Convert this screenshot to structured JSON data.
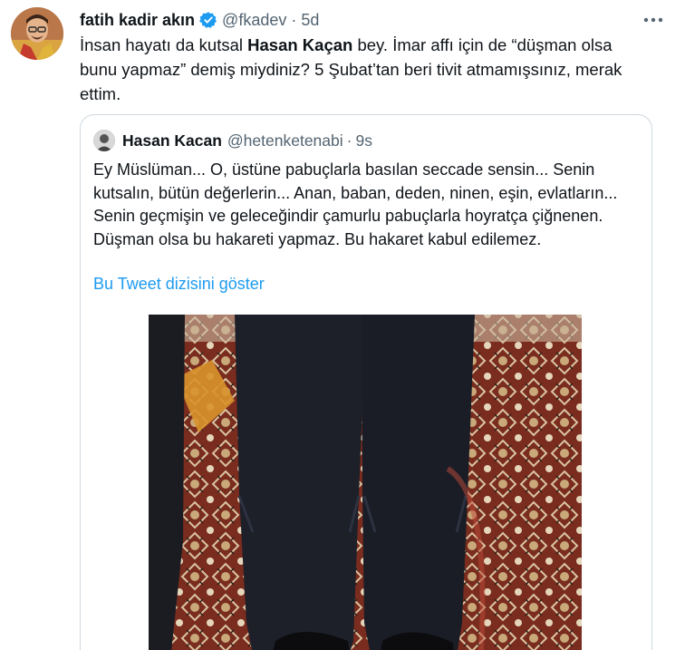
{
  "tweet": {
    "author_name": "fatih kadir akın",
    "handle": "@fkadev",
    "separator": "·",
    "time": "5d",
    "more_icon": "more-icon",
    "text_before": "İnsan hayatı da kutsal ",
    "text_bold": "Hasan Kaçan",
    "text_after": " bey. İmar affı için de “düşman olsa bunu yapmaz” demiş miydiniz? 5 Şubat’tan beri tivit atmamışsınız, merak ettim."
  },
  "quote": {
    "author_name": "Hasan Kacan",
    "handle": "@hetenketenabi",
    "separator": "·",
    "time": "9s",
    "text": "Ey Müslüman... O, üstüne pabuçlarla basılan seccade sensin... Senin kutsalın, bütün değerlerin... Anan, baban, deden, ninen, eşin, evlatların... Senin geçmişin ve geleceğindir çamurlu pabuçlarla hoyratça çiğnenen. Düşman olsa bu hakareti yapmaz. Bu hakaret kabul edilemez.",
    "thread_link": "Bu Tweet dizisini göster"
  },
  "colors": {
    "link": "#1d9bf0",
    "verified": "#1d9bf0",
    "secondary_text": "#536471",
    "border": "#cfd9de"
  }
}
